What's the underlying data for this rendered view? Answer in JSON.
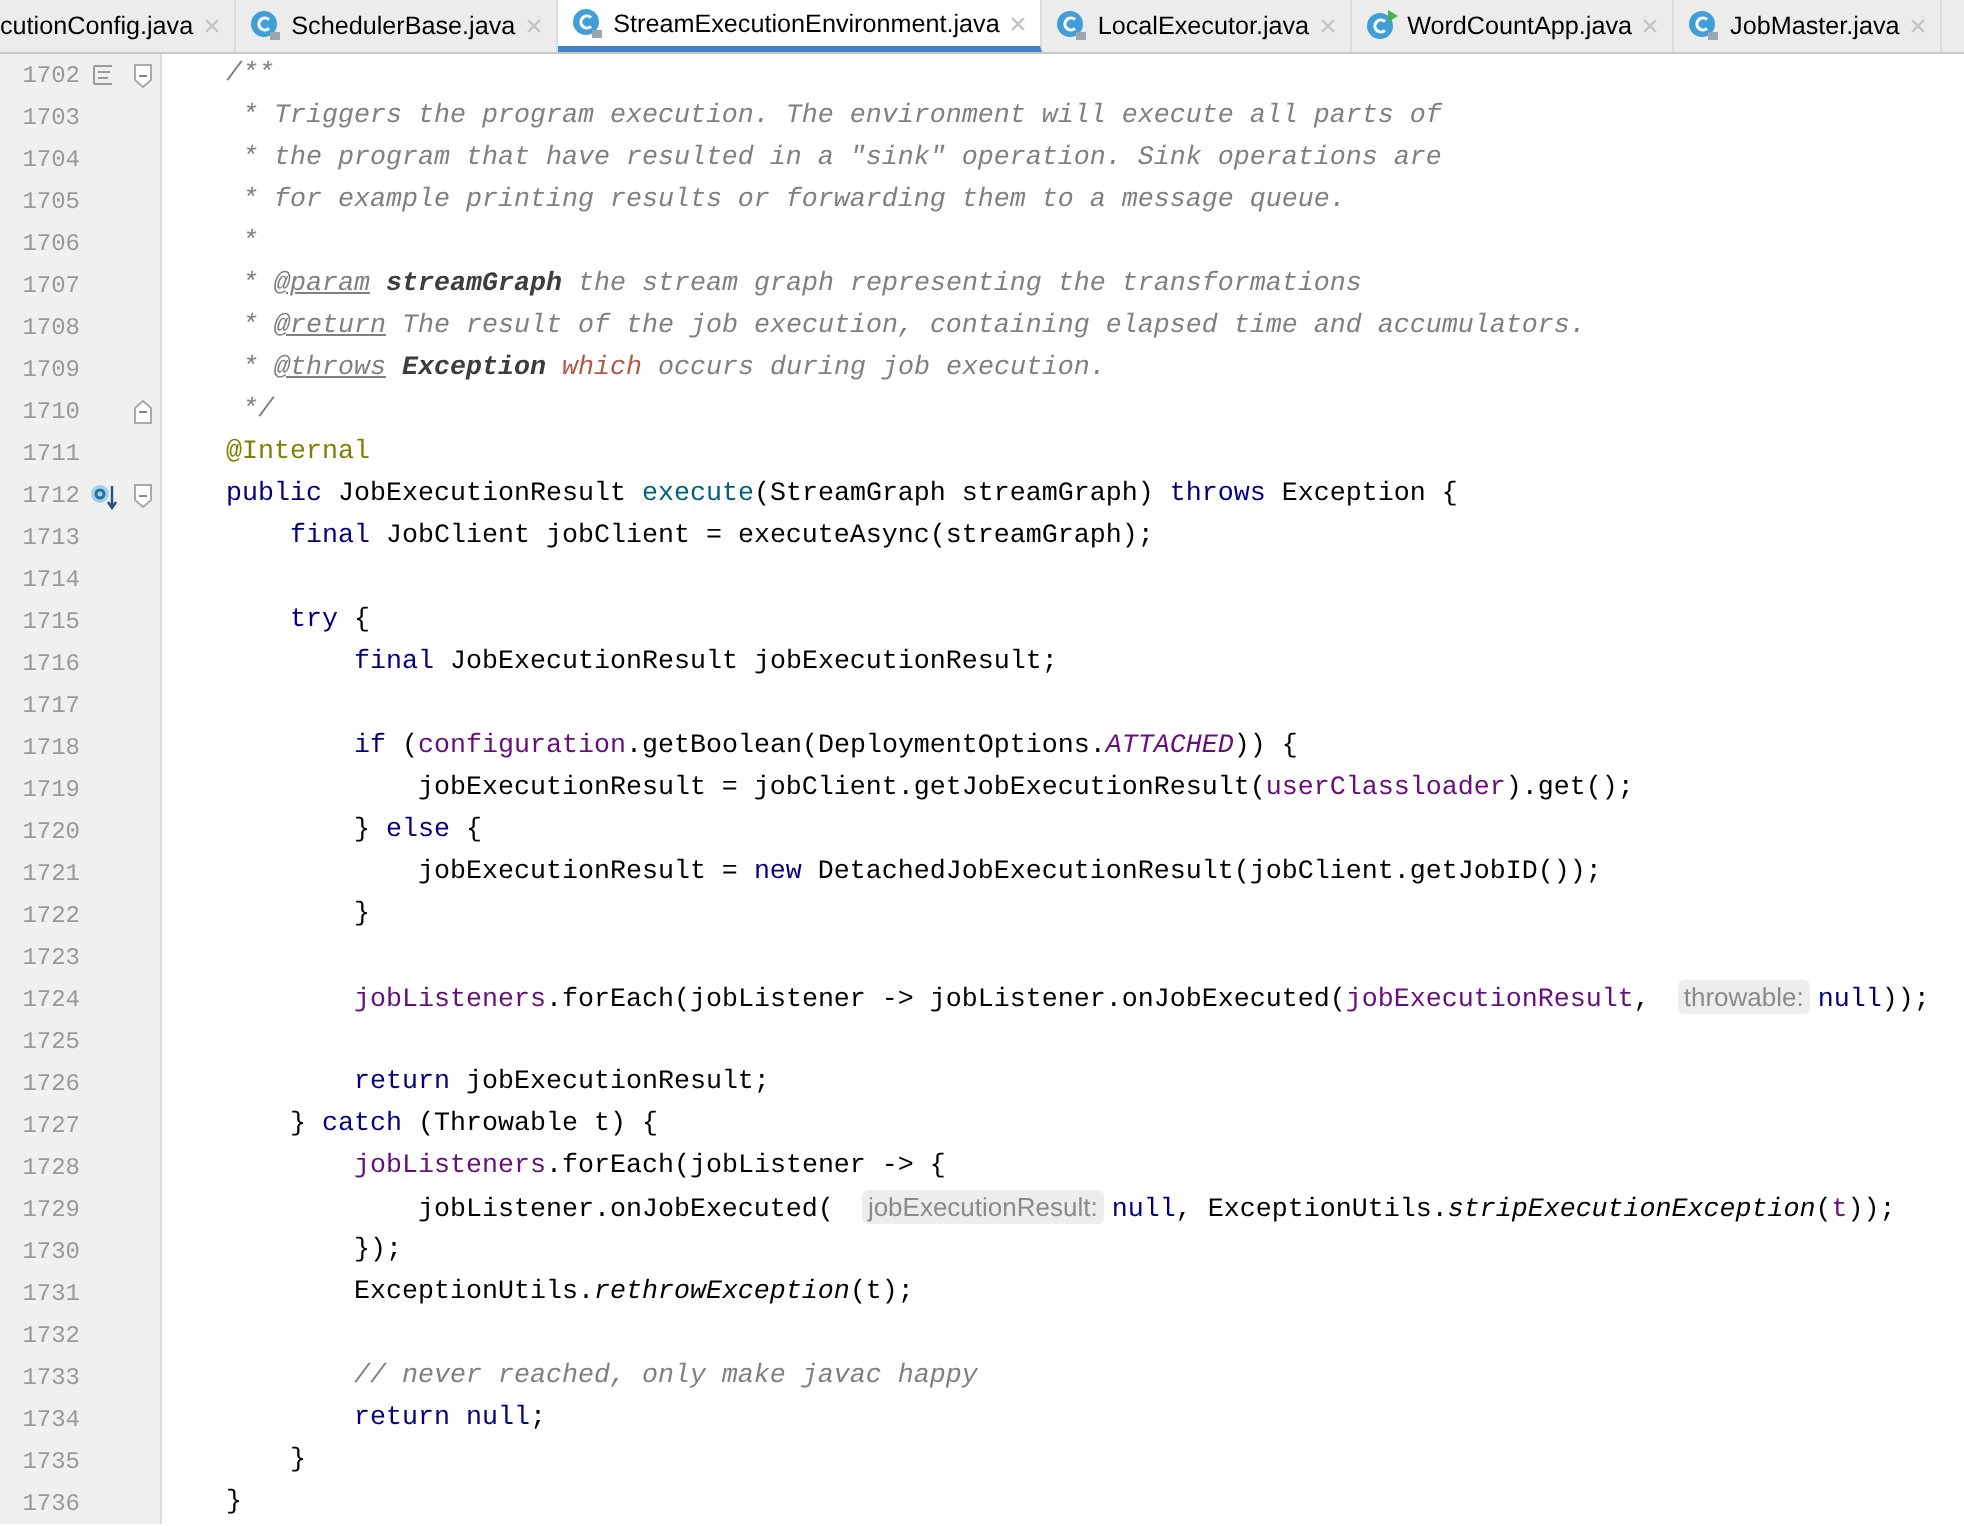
{
  "tabs": [
    {
      "label": "cutionConfig.java",
      "selected": false,
      "kind": "plain"
    },
    {
      "label": "SchedulerBase.java",
      "selected": false,
      "kind": "class"
    },
    {
      "label": "StreamExecutionEnvironment.java",
      "selected": true,
      "kind": "class"
    },
    {
      "label": "LocalExecutor.java",
      "selected": false,
      "kind": "class"
    },
    {
      "label": "WordCountApp.java",
      "selected": false,
      "kind": "runnable-class"
    },
    {
      "label": "JobMaster.java",
      "selected": false,
      "kind": "class"
    }
  ],
  "lines": [
    {
      "number": "1702",
      "gutter": [
        {
          "kind": "doc"
        },
        {
          "kind": "fold-start"
        }
      ],
      "tokens": [
        {
          "kind": "comment",
          "text": "    /**"
        }
      ]
    },
    {
      "number": "1703",
      "tokens": [
        {
          "kind": "comment",
          "text": "     * Triggers the program execution. The environment will execute all parts of"
        }
      ]
    },
    {
      "number": "1704",
      "tokens": [
        {
          "kind": "comment",
          "text": "     * the program that have resulted in a \"sink\" operation. Sink operations are"
        }
      ]
    },
    {
      "number": "1705",
      "tokens": [
        {
          "kind": "comment",
          "text": "     * for example printing results or forwarding them to a message queue."
        }
      ]
    },
    {
      "number": "1706",
      "tokens": [
        {
          "kind": "comment",
          "text": "     *"
        }
      ]
    },
    {
      "number": "1707",
      "tokens": [
        {
          "kind": "comment",
          "text": "     * "
        },
        {
          "kind": "doc-tag",
          "text": "@param"
        },
        {
          "kind": "doc-ref",
          "text": " streamGraph"
        },
        {
          "kind": "comment",
          "text": " the stream graph representing the transformations"
        }
      ]
    },
    {
      "number": "1708",
      "tokens": [
        {
          "kind": "comment",
          "text": "     * "
        },
        {
          "kind": "doc-tag",
          "text": "@return"
        },
        {
          "kind": "comment",
          "text": " The result of the job execution, containing elapsed time and accumulators."
        }
      ]
    },
    {
      "number": "1709",
      "tokens": [
        {
          "kind": "comment",
          "text": "     * "
        },
        {
          "kind": "doc-tag",
          "text": "@throws"
        },
        {
          "kind": "doc-ref",
          "text": " Exception"
        },
        {
          "kind": "flagged",
          "text": " which"
        },
        {
          "kind": "comment",
          "text": " occurs during job execution."
        }
      ]
    },
    {
      "number": "1710",
      "gutter": [
        {
          "kind": "fold-end"
        }
      ],
      "tokens": [
        {
          "kind": "comment",
          "text": "     */"
        }
      ]
    },
    {
      "number": "1711",
      "tokens": [
        {
          "kind": "annotation",
          "text": "    @Internal"
        }
      ]
    },
    {
      "number": "1712",
      "gutter": [
        {
          "kind": "override"
        },
        {
          "kind": "fold-start"
        }
      ],
      "tokens": [
        {
          "kind": "keyword",
          "text": "    public"
        },
        {
          "kind": "plain",
          "text": " JobExecutionResult "
        },
        {
          "kind": "method",
          "text": "execute"
        },
        {
          "kind": "plain",
          "text": "(StreamGraph streamGraph) "
        },
        {
          "kind": "keyword",
          "text": "throws"
        },
        {
          "kind": "plain",
          "text": " Exception {"
        }
      ]
    },
    {
      "number": "1713",
      "tokens": [
        {
          "kind": "keyword",
          "text": "        final"
        },
        {
          "kind": "plain",
          "text": " JobClient jobClient = executeAsync(streamGraph);"
        }
      ]
    },
    {
      "number": "1714"
    },
    {
      "number": "1715",
      "tokens": [
        {
          "kind": "keyword",
          "text": "        try"
        },
        {
          "kind": "plain",
          "text": " {"
        }
      ]
    },
    {
      "number": "1716",
      "tokens": [
        {
          "kind": "keyword",
          "text": "            final"
        },
        {
          "kind": "plain",
          "text": " JobExecutionResult jobExecutionResult;"
        }
      ]
    },
    {
      "number": "1717"
    },
    {
      "number": "1718",
      "tokens": [
        {
          "kind": "keyword",
          "text": "            if"
        },
        {
          "kind": "plain",
          "text": " ("
        },
        {
          "kind": "field",
          "text": "configuration"
        },
        {
          "kind": "plain",
          "text": ".getBoolean(DeploymentOptions."
        },
        {
          "kind": "static",
          "text": "ATTACHED"
        },
        {
          "kind": "plain",
          "text": ")) {"
        }
      ]
    },
    {
      "number": "1719",
      "tokens": [
        {
          "kind": "plain",
          "text": "                jobExecutionResult = jobClient.getJobExecutionResult("
        },
        {
          "kind": "field",
          "text": "userClassloader"
        },
        {
          "kind": "plain",
          "text": ").get();"
        }
      ]
    },
    {
      "number": "1720",
      "tokens": [
        {
          "kind": "plain",
          "text": "            } "
        },
        {
          "kind": "keyword",
          "text": "else"
        },
        {
          "kind": "plain",
          "text": " {"
        }
      ]
    },
    {
      "number": "1721",
      "tokens": [
        {
          "kind": "plain",
          "text": "                jobExecutionResult = "
        },
        {
          "kind": "keyword",
          "text": "new"
        },
        {
          "kind": "plain",
          "text": " DetachedJobExecutionResult(jobClient.getJobID());"
        }
      ]
    },
    {
      "number": "1722",
      "tokens": [
        {
          "kind": "plain",
          "text": "            }"
        }
      ]
    },
    {
      "number": "1723"
    },
    {
      "number": "1724",
      "tokens": [
        {
          "kind": "field",
          "text": "            jobListeners"
        },
        {
          "kind": "plain",
          "text": ".forEach(jobListener -> jobListener.onJobExecuted("
        },
        {
          "kind": "field",
          "text": "jobExecutionResult"
        },
        {
          "kind": "plain",
          "text": ","
        },
        {
          "kind": "hint",
          "text": "throwable:"
        },
        {
          "kind": "keyword",
          "text": "null"
        },
        {
          "kind": "plain",
          "text": "));"
        }
      ]
    },
    {
      "number": "1725"
    },
    {
      "number": "1726",
      "tokens": [
        {
          "kind": "keyword",
          "text": "            return"
        },
        {
          "kind": "plain",
          "text": " jobExecutionResult;"
        }
      ]
    },
    {
      "number": "1727",
      "tokens": [
        {
          "kind": "plain",
          "text": "        } "
        },
        {
          "kind": "keyword",
          "text": "catch"
        },
        {
          "kind": "plain",
          "text": " (Throwable t) {"
        }
      ]
    },
    {
      "number": "1728",
      "tokens": [
        {
          "kind": "field",
          "text": "            jobListeners"
        },
        {
          "kind": "plain",
          "text": ".forEach(jobListener -> {"
        }
      ]
    },
    {
      "number": "1729",
      "tokens": [
        {
          "kind": "plain",
          "text": "                jobListener.onJobExecuted("
        },
        {
          "kind": "hint",
          "text": "jobExecutionResult:"
        },
        {
          "kind": "keyword",
          "text": "null"
        },
        {
          "kind": "plain",
          "text": ", ExceptionUtils."
        },
        {
          "kind": "static-method",
          "text": "stripExecutionException"
        },
        {
          "kind": "plain",
          "text": "("
        },
        {
          "kind": "field",
          "text": "t"
        },
        {
          "kind": "plain",
          "text": "));"
        }
      ]
    },
    {
      "number": "1730",
      "tokens": [
        {
          "kind": "plain",
          "text": "            });"
        }
      ]
    },
    {
      "number": "1731",
      "tokens": [
        {
          "kind": "plain",
          "text": "            ExceptionUtils."
        },
        {
          "kind": "static-method",
          "text": "rethrowException"
        },
        {
          "kind": "plain",
          "text": "(t);"
        }
      ]
    },
    {
      "number": "1732"
    },
    {
      "number": "1733",
      "tokens": [
        {
          "kind": "comment",
          "text": "            // never reached, only make javac happy"
        }
      ]
    },
    {
      "number": "1734",
      "tokens": [
        {
          "kind": "keyword",
          "text": "            return"
        },
        {
          "kind": "keyword",
          "text": " null"
        },
        {
          "kind": "plain",
          "text": ";"
        }
      ]
    },
    {
      "number": "1735",
      "tokens": [
        {
          "kind": "plain",
          "text": "        }"
        }
      ]
    },
    {
      "number": "1736",
      "tokens": [
        {
          "kind": "plain",
          "text": "    }"
        }
      ]
    }
  ]
}
